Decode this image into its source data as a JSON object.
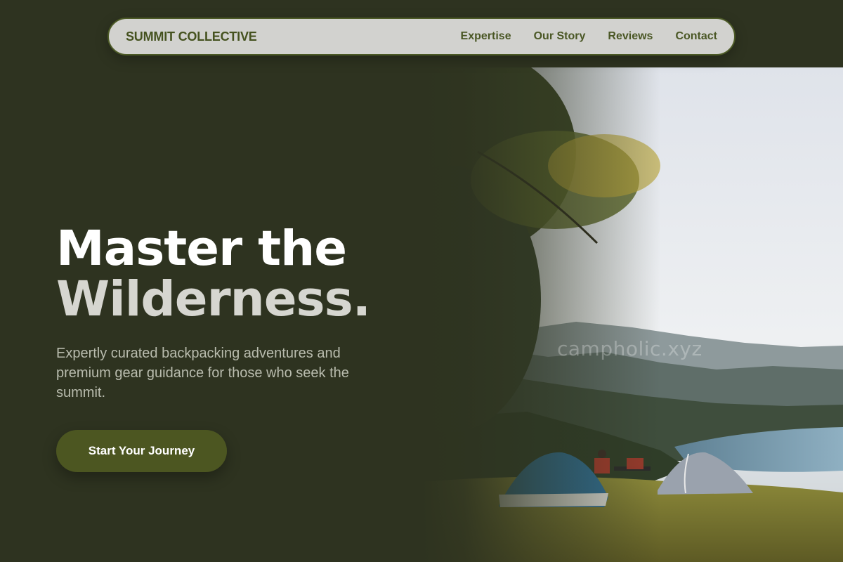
{
  "nav": {
    "brand": "SUMMIT COLLECTIVE",
    "links": [
      {
        "label": "Expertise"
      },
      {
        "label": "Our Story"
      },
      {
        "label": "Reviews"
      },
      {
        "label": "Contact"
      }
    ]
  },
  "hero": {
    "title_line1": "Master the",
    "title_line2": "Wilderness.",
    "subtitle": "Expertly curated backpacking adventures and premium gear guidance for those who seek the summit.",
    "cta_label": "Start Your Journey",
    "watermark": "campholic.xyz"
  },
  "colors": {
    "background": "#2e3320",
    "nav_background": "#d2d2cf",
    "accent": "#4c5621",
    "brand_text": "#45521f"
  }
}
